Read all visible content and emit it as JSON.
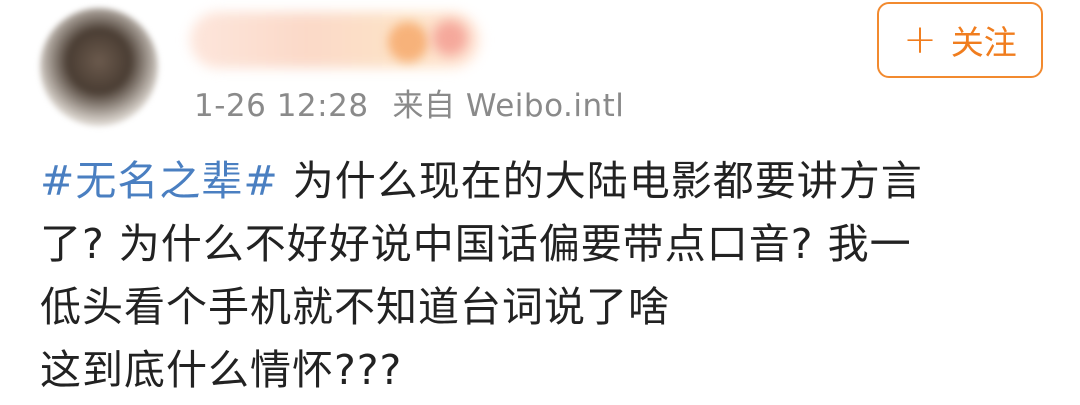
{
  "post": {
    "time": "1-26 12:28",
    "source": "来自 Weibo.intl",
    "follow_label": "关注",
    "follow_icon": "plus-icon",
    "hashtag": "#无名之辈#",
    "lines": [
      " 为什么现在的大陆电影都要讲方言",
      "了? 为什么不好好说中国话偏要带点口音? 我一",
      "低头看个手机就不知道台词说了啥",
      "这到底什么情怀???"
    ]
  },
  "colors": {
    "accent": "#f07d1e",
    "hashtag": "#4a7fc1",
    "meta": "#8a8a8a",
    "text": "#222222"
  }
}
